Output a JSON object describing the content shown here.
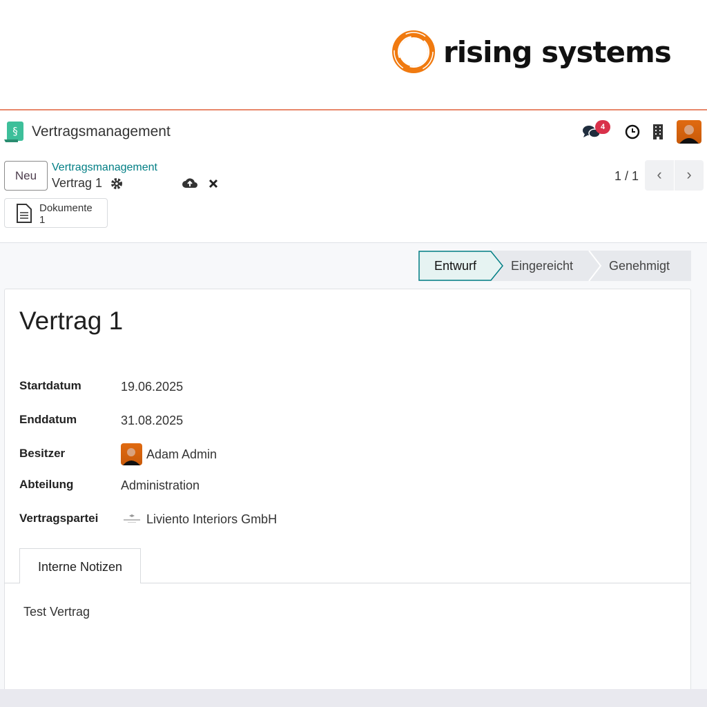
{
  "brand": {
    "logo_text": "rising systems",
    "accent": "#f07a10"
  },
  "navbar": {
    "app_title": "Vertragsmanagement",
    "app_icon": "section-sign-icon",
    "messages_count": "4",
    "topline_color": "#e8876a"
  },
  "control_panel": {
    "new_label": "Neu",
    "breadcrumb_parent": "Vertragsmanagement",
    "breadcrumb_current": "Vertrag 1",
    "pager": "1 / 1",
    "prev": "‹",
    "next": "›"
  },
  "smart_button": {
    "label": "Dokumente",
    "count": "1"
  },
  "statusbar": {
    "stages": [
      "Entwurf",
      "Eingereicht",
      "Genehmigt"
    ],
    "active": "Entwurf"
  },
  "form": {
    "title": "Vertrag 1",
    "fields": [
      {
        "label": "Startdatum",
        "value": "19.06.2025"
      },
      {
        "label": "Enddatum",
        "value": "31.08.2025"
      },
      {
        "label": "Besitzer",
        "value": "Adam Admin"
      },
      {
        "label": "Abteilung",
        "value": "Administration"
      },
      {
        "label": "Vertragspartei",
        "value": "Liviento Interiors GmbH"
      }
    ],
    "tabs": [
      {
        "label": "Interne Notizen"
      }
    ],
    "notes": "Test Vertrag"
  }
}
